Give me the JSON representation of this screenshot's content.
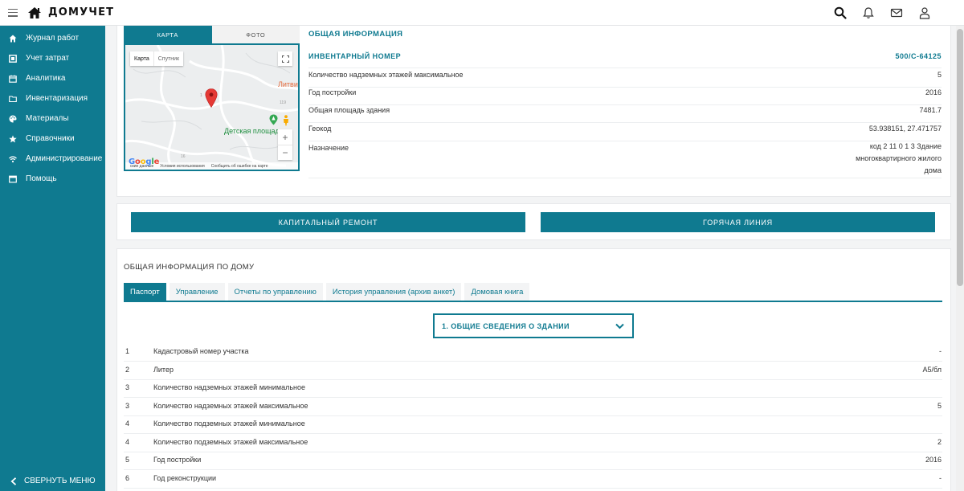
{
  "app": {
    "logo_text": "ДОМУЧЕТ",
    "icons": [
      "menu-icon",
      "home-icon",
      "search-icon",
      "bell-icon",
      "mail-icon",
      "user-icon"
    ]
  },
  "sidebar": {
    "items": [
      {
        "label": "Журнал работ",
        "icon": "home-icon"
      },
      {
        "label": "Учет затрат",
        "icon": "wallet-icon"
      },
      {
        "label": "Аналитика",
        "icon": "calendar-icon"
      },
      {
        "label": "Инвентаризация",
        "icon": "folder-icon"
      },
      {
        "label": "Материалы",
        "icon": "palette-icon"
      },
      {
        "label": "Справочники",
        "icon": "star-icon"
      },
      {
        "label": "Администрирование",
        "icon": "wifi-icon"
      },
      {
        "label": "Помощь",
        "icon": "window-icon"
      }
    ],
    "collapse_label": "СВЕРНУТЬ МЕНЮ"
  },
  "map": {
    "tabs": {
      "map": "КАРТА",
      "photo": "ФОТО"
    },
    "type_map": "Карта",
    "type_satellite": "Спутник",
    "place_red": "Литви",
    "place_green": "Детская площадка",
    "road_numbers": [
      "1",
      "119",
      "16"
    ],
    "footer": {
      "data": "ские данные",
      "terms": "Условия использования",
      "report": "Сообщить об ошибке на карте"
    },
    "google": "Google"
  },
  "general": {
    "title": "ОБЩАЯ ИНФОРМАЦИЯ",
    "inventory_label": "ИНВЕНТАРНЫЙ НОМЕР",
    "inventory_value": "500/С-64125",
    "rows": [
      {
        "label": "Количество надземных этажей максимальное",
        "value": "5"
      },
      {
        "label": "Год постройки",
        "value": "2016"
      },
      {
        "label": "Общая площадь здания",
        "value": "7481.7"
      },
      {
        "label": "Геокод",
        "value": "53.938151, 27.471757"
      },
      {
        "label": "Назначение",
        "value": "код 2 11 0 1 3 Здание многоквартирного жилого дома"
      }
    ]
  },
  "buttons": {
    "capital": "КАПИТАЛЬНЫЙ РЕМОНТ",
    "hotline": "ГОРЯЧАЯ ЛИНИЯ"
  },
  "house": {
    "title": "ОБЩАЯ ИНФОРМАЦИЯ ПО ДОМУ",
    "tabs": [
      "Паспорт",
      "Управление",
      "Отчеты по управлению",
      "История управления (архив анкет)",
      "Домовая книга"
    ],
    "active_tab": "Паспорт",
    "section_selected": "1. ОБЩИЕ СВЕДЕНИЯ О ЗДАНИИ",
    "rows": [
      {
        "num": "1",
        "label": "Кадастровый номер участка",
        "value": "-"
      },
      {
        "num": "2",
        "label": "Литер",
        "value": "А5/бл"
      },
      {
        "num": "3",
        "label": "Количество надземных этажей минимальное",
        "value": ""
      },
      {
        "num": "3",
        "label": "Количество надземных этажей максимальное",
        "value": "5"
      },
      {
        "num": "4",
        "label": "Количество подземных этажей минимальное",
        "value": ""
      },
      {
        "num": "4",
        "label": "Количество подземных этажей максимальное",
        "value": "2"
      },
      {
        "num": "5",
        "label": "Год постройки",
        "value": "2016"
      },
      {
        "num": "6",
        "label": "Год реконструкции",
        "value": "-"
      }
    ]
  },
  "colors": {
    "accent": "#0f7a90",
    "background": "#f3f4f5"
  }
}
